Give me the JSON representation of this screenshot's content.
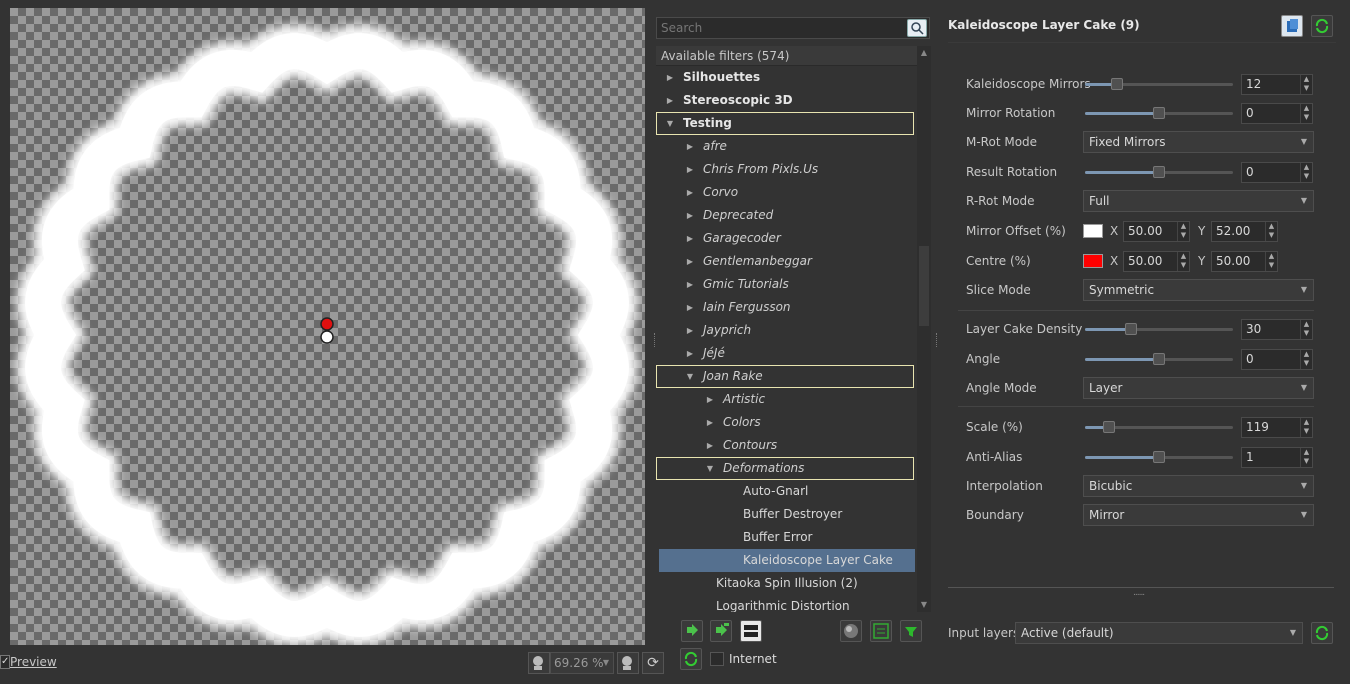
{
  "search": {
    "placeholder": "Search"
  },
  "tree": {
    "header": "Available filters (574)",
    "rows": [
      {
        "label": "Silhouettes",
        "style": "bold",
        "level": 0,
        "arrow": "right"
      },
      {
        "label": "Stereoscopic 3D",
        "style": "bold",
        "level": 0,
        "arrow": "right"
      },
      {
        "label": "Testing",
        "style": "bold",
        "level": 0,
        "arrow": "down",
        "highlight": true
      },
      {
        "label": "afre",
        "style": "ital",
        "level": 1,
        "arrow": "right"
      },
      {
        "label": "Chris From Pixls.Us",
        "style": "ital",
        "level": 1,
        "arrow": "right"
      },
      {
        "label": "Corvo",
        "style": "ital",
        "level": 1,
        "arrow": "right"
      },
      {
        "label": "Deprecated",
        "style": "ital",
        "level": 1,
        "arrow": "right"
      },
      {
        "label": "Garagecoder",
        "style": "ital",
        "level": 1,
        "arrow": "right"
      },
      {
        "label": "Gentlemanbeggar",
        "style": "ital",
        "level": 1,
        "arrow": "right"
      },
      {
        "label": "Gmic Tutorials",
        "style": "ital",
        "level": 1,
        "arrow": "right"
      },
      {
        "label": "Iain Fergusson",
        "style": "ital",
        "level": 1,
        "arrow": "right"
      },
      {
        "label": "Jayprich",
        "style": "ital",
        "level": 1,
        "arrow": "right"
      },
      {
        "label": "JéJé",
        "style": "ital",
        "level": 1,
        "arrow": "right"
      },
      {
        "label": "Joan Rake",
        "style": "ital",
        "level": 1,
        "arrow": "down",
        "highlight": true
      },
      {
        "label": "Artistic",
        "style": "ital",
        "level": 2,
        "arrow": "right"
      },
      {
        "label": "Colors",
        "style": "ital",
        "level": 2,
        "arrow": "right"
      },
      {
        "label": "Contours",
        "style": "ital",
        "level": 2,
        "arrow": "right"
      },
      {
        "label": "Deformations",
        "style": "ital",
        "level": 2,
        "arrow": "down",
        "highlight": true
      },
      {
        "label": "Auto-Gnarl",
        "style": "plain",
        "level": 3,
        "arrow": ""
      },
      {
        "label": "Buffer Destroyer",
        "style": "plain",
        "level": 3,
        "arrow": ""
      },
      {
        "label": "Buffer Error",
        "style": "plain",
        "level": 3,
        "arrow": ""
      },
      {
        "label": "Kaleidoscope Layer Cake",
        "style": "plain",
        "level": 3,
        "arrow": "",
        "selected": true
      },
      {
        "label": "Kitaoka Spin Illusion (2)",
        "style": "plain",
        "level": 2.6,
        "arrow": ""
      },
      {
        "label": "Logarithmic Distortion",
        "style": "plain",
        "level": 2.6,
        "arrow": ""
      }
    ]
  },
  "preview": {
    "label": "Preview",
    "zoom": "69.26 %"
  },
  "internet": {
    "label": "Internet"
  },
  "filter": {
    "title": "Kaleidoscope Layer Cake (9)"
  },
  "params": {
    "mirrors": {
      "label": "Kaleidoscope Mirrors",
      "value": "12",
      "fraction": 0.2
    },
    "mirror_rotation": {
      "label": "Mirror Rotation",
      "value": "0",
      "fraction": 0.5
    },
    "mrot_mode": {
      "label": "M-Rot Mode",
      "value": "Fixed Mirrors"
    },
    "result_rotation": {
      "label": "Result Rotation",
      "value": "0",
      "fraction": 0.5
    },
    "rrot_mode": {
      "label": "R-Rot Mode",
      "value": "Full"
    },
    "mirror_offset": {
      "label": "Mirror Offset (%)",
      "x_label": "X",
      "y_label": "Y",
      "x": "50.00",
      "y": "52.00",
      "color": "#ffffff"
    },
    "centre": {
      "label": "Centre (%)",
      "x_label": "X",
      "y_label": "Y",
      "x": "50.00",
      "y": "50.00",
      "color": "#ff0000"
    },
    "slice_mode": {
      "label": "Slice Mode",
      "value": "Symmetric"
    },
    "density": {
      "label": "Layer Cake Density",
      "value": "30",
      "fraction": 0.3
    },
    "angle": {
      "label": "Angle",
      "value": "0",
      "fraction": 0.5
    },
    "angle_mode": {
      "label": "Angle Mode",
      "value": "Layer"
    },
    "scale": {
      "label": "Scale (%)",
      "value": "119",
      "fraction": 0.14
    },
    "antialias": {
      "label": "Anti-Alias",
      "value": "1",
      "fraction": 0.5
    },
    "interpolation": {
      "label": "Interpolation",
      "value": "Bicubic"
    },
    "boundary": {
      "label": "Boundary",
      "value": "Mirror"
    }
  },
  "input_layers": {
    "label": "Input layers",
    "value": "Active (default)"
  },
  "splitter_grip": "......"
}
